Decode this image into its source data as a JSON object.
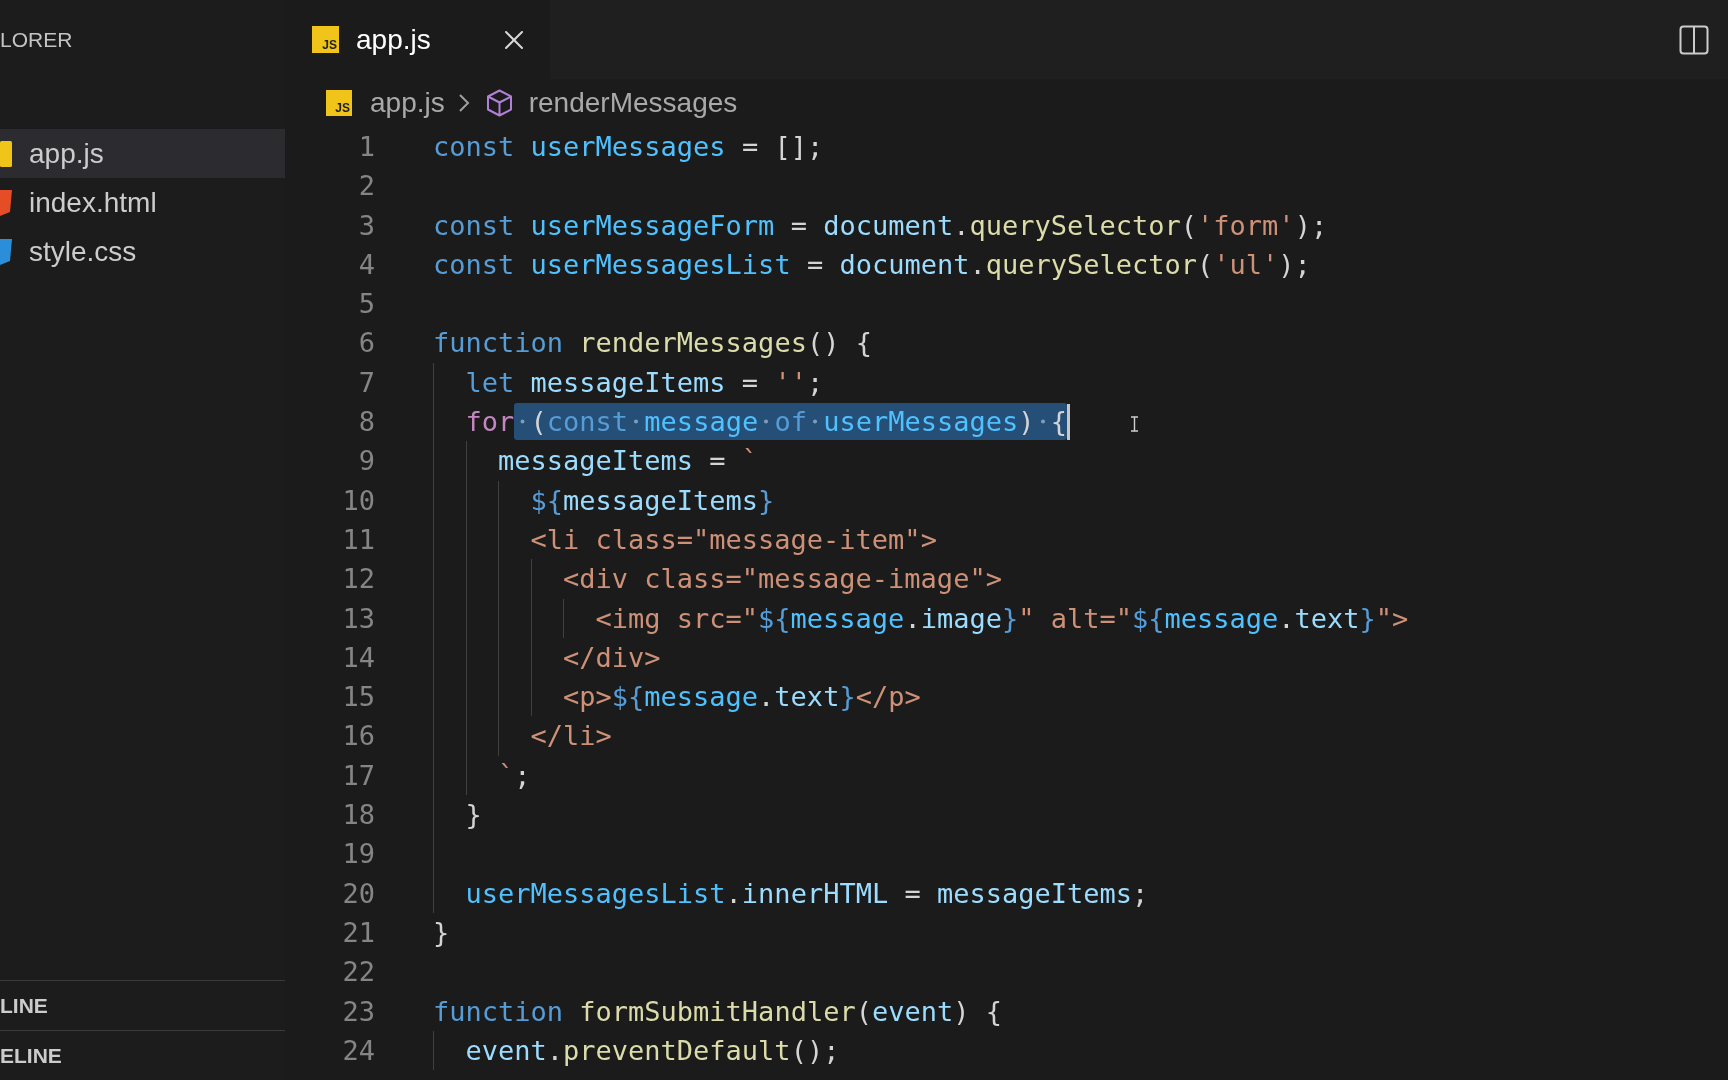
{
  "sidebar": {
    "header": "LORER",
    "files": [
      {
        "name": "app.js",
        "kind": "js",
        "selected": true
      },
      {
        "name": "index.html",
        "kind": "html",
        "selected": false
      },
      {
        "name": "style.css",
        "kind": "css",
        "selected": false
      }
    ],
    "sections": [
      "LINE",
      "ELINE"
    ]
  },
  "tabs": [
    {
      "label": "app.js",
      "icon_text": "JS",
      "selected": true
    }
  ],
  "breadcrumbs": [
    {
      "label": "app.js",
      "kind": "file",
      "icon_text": "JS"
    },
    {
      "label": "renderMessages",
      "kind": "symbol"
    }
  ],
  "editor": {
    "lines": [
      {
        "number": "1",
        "tokens": [
          {
            "kind": "storage",
            "text": "const "
          },
          {
            "kind": "constant",
            "text": "userMessages"
          },
          {
            "kind": "plain",
            "text": " = [];"
          }
        ]
      },
      {
        "number": "2"
      },
      {
        "number": "3",
        "tokens": [
          {
            "kind": "storage",
            "text": "const "
          },
          {
            "kind": "constant",
            "text": "userMessageForm"
          },
          {
            "kind": "plain",
            "text": " = "
          },
          {
            "kind": "variable",
            "text": "document"
          },
          {
            "kind": "plain",
            "text": "."
          },
          {
            "kind": "function",
            "text": "querySelector"
          },
          {
            "kind": "plain",
            "text": "("
          },
          {
            "kind": "string",
            "text": "'form'"
          },
          {
            "kind": "plain",
            "text": ");"
          }
        ]
      },
      {
        "number": "4",
        "tokens": [
          {
            "kind": "storage",
            "text": "const "
          },
          {
            "kind": "constant",
            "text": "userMessagesList"
          },
          {
            "kind": "plain",
            "text": " = "
          },
          {
            "kind": "variable",
            "text": "document"
          },
          {
            "kind": "plain",
            "text": "."
          },
          {
            "kind": "function",
            "text": "querySelector"
          },
          {
            "kind": "plain",
            "text": "("
          },
          {
            "kind": "string",
            "text": "'ul'"
          },
          {
            "kind": "plain",
            "text": ");"
          }
        ]
      },
      {
        "number": "5"
      },
      {
        "number": "6",
        "tokens": [
          {
            "kind": "storage",
            "text": "function "
          },
          {
            "kind": "function",
            "text": "renderMessages"
          },
          {
            "kind": "plain",
            "text": "() {"
          }
        ],
        "children": [
          {
            "number": "7",
            "tokens": [
              {
                "kind": "storage",
                "text": "let "
              },
              {
                "kind": "variable",
                "text": "messageItems"
              },
              {
                "kind": "plain",
                "text": " = "
              },
              {
                "kind": "string",
                "text": "''"
              },
              {
                "kind": "plain",
                "text": ";"
              }
            ]
          },
          {
            "number": "8",
            "tokens": [
              {
                "kind": "control",
                "text": "for"
              }
            ],
            "selection": {
              "tokens": [
                {
                  "kind": "plain",
                  "text": " ("
                },
                {
                  "kind": "storage",
                  "text": "const "
                },
                {
                  "kind": "constant",
                  "text": "message "
                },
                {
                  "kind": "storage",
                  "text": "of "
                },
                {
                  "kind": "constant",
                  "text": "userMessages"
                },
                {
                  "kind": "plain",
                  "text": ") {"
                }
              ],
              "cursor": true
            },
            "children": [
              {
                "number": "9",
                "tokens": [
                  {
                    "kind": "variable",
                    "text": "messageItems"
                  },
                  {
                    "kind": "plain",
                    "text": " = "
                  },
                  {
                    "kind": "string",
                    "text": "`"
                  }
                ],
                "children": [
                  {
                    "number": "10",
                    "tokens": [
                      {
                        "kind": "template",
                        "text": "${"
                      },
                      {
                        "kind": "variable",
                        "text": "messageItems"
                      },
                      {
                        "kind": "template",
                        "text": "}"
                      }
                    ]
                  },
                  {
                    "number": "11",
                    "tokens": [
                      {
                        "kind": "string",
                        "text": "<li class=\"message-item\">"
                      }
                    ],
                    "children": [
                      {
                        "number": "12",
                        "tokens": [
                          {
                            "kind": "string",
                            "text": "<div class=\"message-image\">"
                          }
                        ],
                        "children": [
                          {
                            "number": "13",
                            "tokens": [
                              {
                                "kind": "string",
                                "text": "<img src=\""
                              },
                              {
                                "kind": "template",
                                "text": "${"
                              },
                              {
                                "kind": "constant",
                                "text": "message"
                              },
                              {
                                "kind": "plain",
                                "text": "."
                              },
                              {
                                "kind": "variable",
                                "text": "image"
                              },
                              {
                                "kind": "template",
                                "text": "}"
                              },
                              {
                                "kind": "string",
                                "text": "\" alt=\""
                              },
                              {
                                "kind": "template",
                                "text": "${"
                              },
                              {
                                "kind": "constant",
                                "text": "message"
                              },
                              {
                                "kind": "plain",
                                "text": "."
                              },
                              {
                                "kind": "variable",
                                "text": "text"
                              },
                              {
                                "kind": "template",
                                "text": "}"
                              },
                              {
                                "kind": "string",
                                "text": "\">"
                              }
                            ]
                          }
                        ]
                      },
                      {
                        "number": "14",
                        "tokens": [
                          {
                            "kind": "string",
                            "text": "</div>"
                          }
                        ]
                      },
                      {
                        "number": "15",
                        "tokens": [
                          {
                            "kind": "string",
                            "text": "<p>"
                          },
                          {
                            "kind": "template",
                            "text": "${"
                          },
                          {
                            "kind": "constant",
                            "text": "message"
                          },
                          {
                            "kind": "plain",
                            "text": "."
                          },
                          {
                            "kind": "variable",
                            "text": "text"
                          },
                          {
                            "kind": "template",
                            "text": "}"
                          },
                          {
                            "kind": "string",
                            "text": "</p>"
                          }
                        ]
                      }
                    ]
                  },
                  {
                    "number": "16",
                    "tokens": [
                      {
                        "kind": "string",
                        "text": "</li>"
                      }
                    ]
                  }
                ]
              },
              {
                "number": "17",
                "tokens": [
                  {
                    "kind": "string",
                    "text": "`"
                  },
                  {
                    "kind": "plain",
                    "text": ";"
                  }
                ]
              }
            ]
          },
          {
            "number": "18",
            "tokens": [
              {
                "kind": "plain",
                "text": "}"
              }
            ]
          },
          {
            "number": "19"
          },
          {
            "number": "20",
            "tokens": [
              {
                "kind": "constant",
                "text": "userMessagesList"
              },
              {
                "kind": "plain",
                "text": "."
              },
              {
                "kind": "variable",
                "text": "innerHTML"
              },
              {
                "kind": "plain",
                "text": " = "
              },
              {
                "kind": "variable",
                "text": "messageItems"
              },
              {
                "kind": "plain",
                "text": ";"
              }
            ]
          }
        ]
      },
      {
        "number": "21",
        "tokens": [
          {
            "kind": "plain",
            "text": "}"
          }
        ]
      },
      {
        "number": "22"
      },
      {
        "number": "23",
        "tokens": [
          {
            "kind": "storage",
            "text": "function "
          },
          {
            "kind": "function",
            "text": "formSubmitHandler"
          },
          {
            "kind": "plain",
            "text": "("
          },
          {
            "kind": "variable",
            "text": "event"
          },
          {
            "kind": "plain",
            "text": ") {"
          }
        ],
        "children": [
          {
            "number": "24",
            "tokens": [
              {
                "kind": "variable",
                "text": "event"
              },
              {
                "kind": "plain",
                "text": "."
              },
              {
                "kind": "function",
                "text": "preventDefault"
              },
              {
                "kind": "plain",
                "text": "();"
              }
            ]
          }
        ]
      }
    ]
  }
}
